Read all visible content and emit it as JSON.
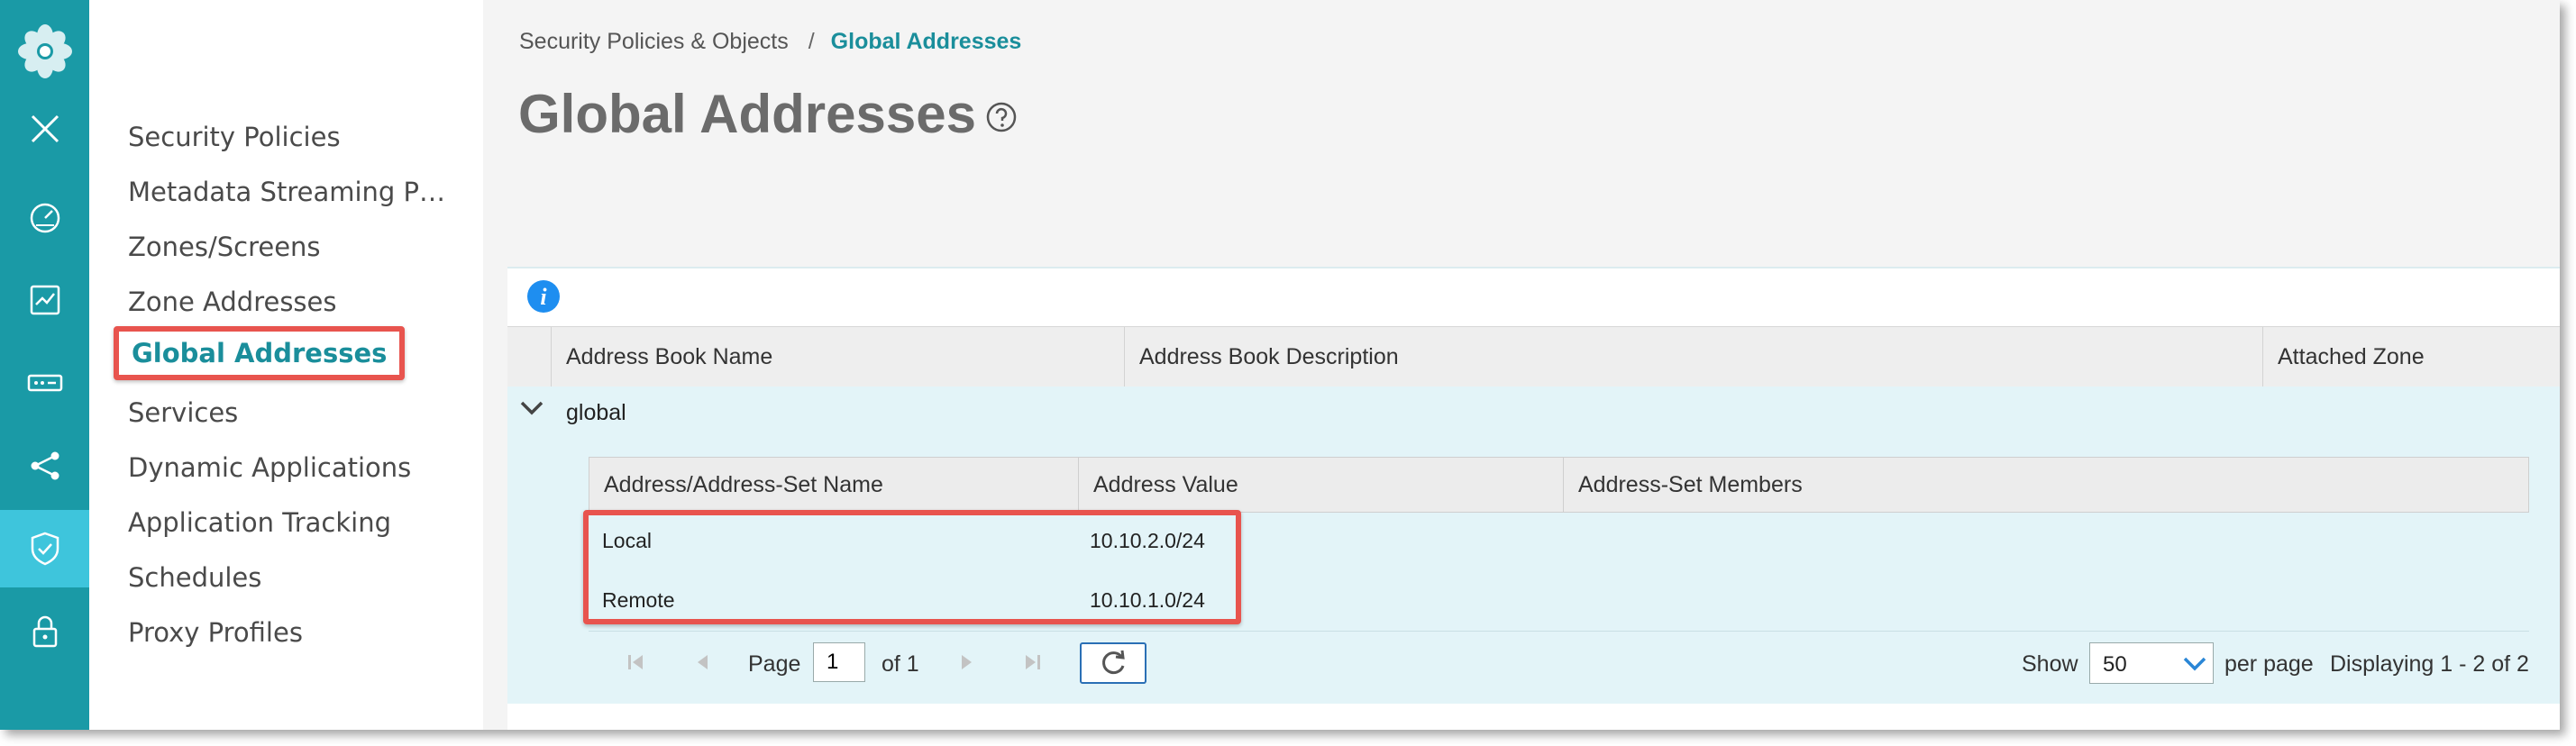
{
  "rail": {
    "icons": [
      "logo-flower-icon",
      "close-icon",
      "dashboard-gauge-icon",
      "monitor-chart-icon",
      "devices-icon",
      "network-share-icon",
      "security-shield-icon",
      "lock-icon"
    ]
  },
  "nav": {
    "items": [
      {
        "label": "Security Policies"
      },
      {
        "label": "Metadata Streaming P…"
      },
      {
        "label": "Zones/Screens"
      },
      {
        "label": "Zone Addresses"
      },
      {
        "label": "Global Addresses",
        "selected": true
      },
      {
        "label": "Services"
      },
      {
        "label": "Dynamic Applications"
      },
      {
        "label": "Application Tracking"
      },
      {
        "label": "Schedules"
      },
      {
        "label": "Proxy Profiles"
      }
    ]
  },
  "breadcrumb": {
    "parent": "Security Policies & Objects",
    "separator": "/",
    "current": "Global Addresses"
  },
  "page": {
    "title": "Global Addresses"
  },
  "grid": {
    "columns": [
      "Address Book Name",
      "Address Book Description",
      "Attached Zone"
    ],
    "group": {
      "name": "global"
    },
    "sub_columns": [
      "Address/Address-Set Name",
      "Address Value",
      "Address-Set Members"
    ],
    "rows": [
      {
        "name": "Local",
        "value": "10.10.2.0/24",
        "members": ""
      },
      {
        "name": "Remote",
        "value": "10.10.1.0/24",
        "members": ""
      }
    ]
  },
  "pager": {
    "page_label": "Page",
    "page_value": "1",
    "of_label": "of 1",
    "show_label": "Show",
    "per_page_value": "50",
    "per_page_label": "per page",
    "displaying": "Displaying 1 - 2 of 2"
  },
  "colors": {
    "rail": "#1a9aa6",
    "rail_active": "#3ec5dc",
    "accent": "#1a8e9b",
    "highlight": "#e8544e",
    "grid_bg": "#e3f4f8"
  }
}
